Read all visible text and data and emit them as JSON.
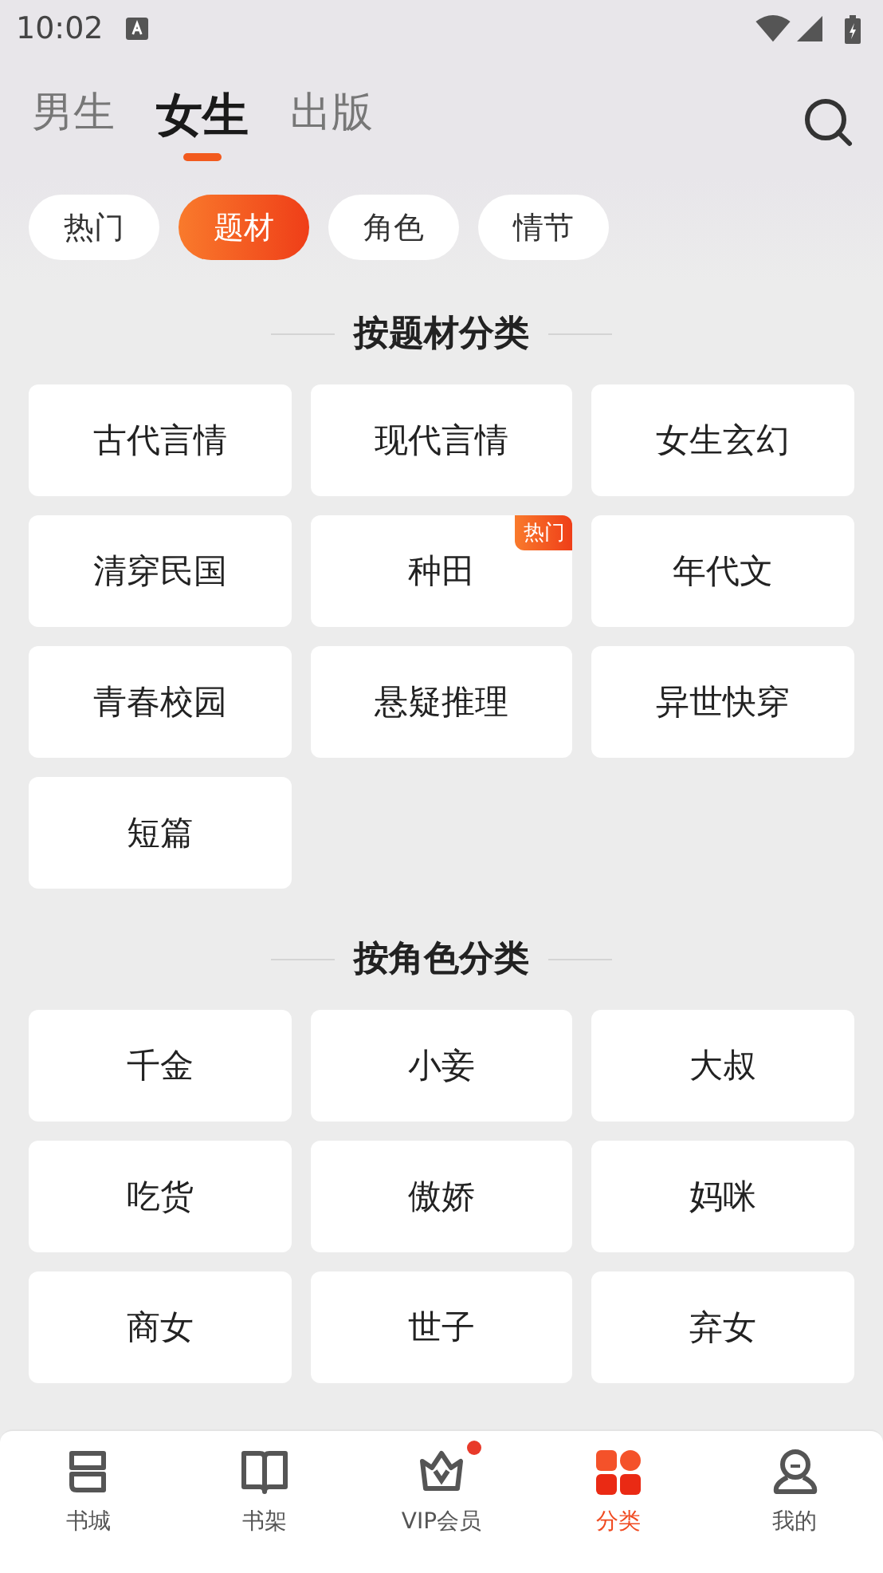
{
  "status_bar": {
    "time": "10:02"
  },
  "tabs": [
    {
      "label": "男生",
      "selected": false
    },
    {
      "label": "女生",
      "selected": true
    },
    {
      "label": "出版",
      "selected": false
    }
  ],
  "chips": [
    {
      "label": "热门",
      "selected": false
    },
    {
      "label": "题材",
      "selected": true
    },
    {
      "label": "角色",
      "selected": false
    },
    {
      "label": "情节",
      "selected": false
    }
  ],
  "sections": [
    {
      "title": "按题材分类",
      "items": [
        {
          "label": "古代言情"
        },
        {
          "label": "现代言情"
        },
        {
          "label": "女生玄幻"
        },
        {
          "label": "清穿民国"
        },
        {
          "label": "种田",
          "badge": "热门"
        },
        {
          "label": "年代文"
        },
        {
          "label": "青春校园"
        },
        {
          "label": "悬疑推理"
        },
        {
          "label": "异世快穿"
        },
        {
          "label": "短篇"
        }
      ]
    },
    {
      "title": "按角色分类",
      "items": [
        {
          "label": "千金"
        },
        {
          "label": "小妾"
        },
        {
          "label": "大叔"
        },
        {
          "label": "吃货"
        },
        {
          "label": "傲娇"
        },
        {
          "label": "妈咪"
        },
        {
          "label": "商女"
        },
        {
          "label": "世子"
        },
        {
          "label": "弃女"
        }
      ]
    }
  ],
  "bottom_nav": [
    {
      "label": "书城",
      "kind": "store",
      "selected": false,
      "dot": false
    },
    {
      "label": "书架",
      "kind": "book",
      "selected": false,
      "dot": false
    },
    {
      "label": "VIP会员",
      "kind": "crown",
      "selected": false,
      "dot": true
    },
    {
      "label": "分类",
      "kind": "grid",
      "selected": true,
      "dot": false
    },
    {
      "label": "我的",
      "kind": "user",
      "selected": false,
      "dot": false
    }
  ]
}
